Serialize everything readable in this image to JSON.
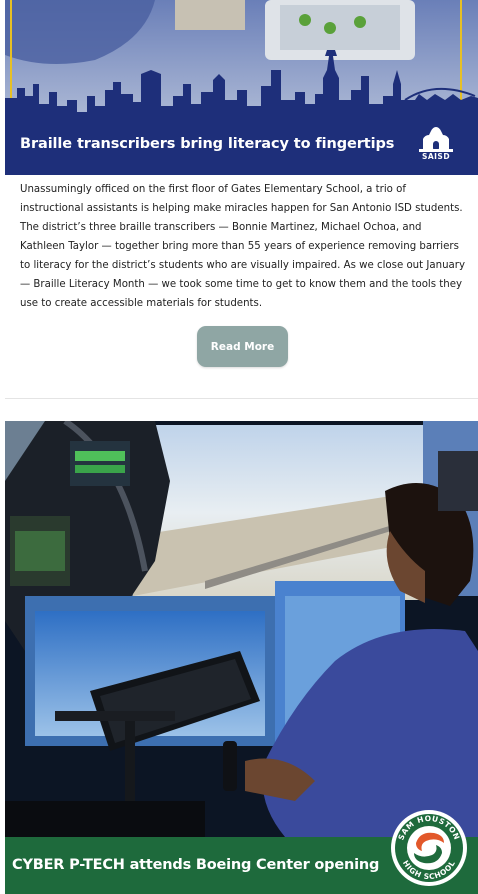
{
  "colors": {
    "saisd_banner": "#1e2f7a",
    "read_more_button": "#8fa6a4",
    "sam_houston_banner": "#1e6a3c",
    "sam_houston_orange": "#e2582a"
  },
  "stories": [
    {
      "title": "Braille transcribers bring literacy to fingertips",
      "logo_text": "SAISD",
      "logo_icon": "saisd-alamo-icon",
      "body": "Unassumingly officed on the first floor of Gates Elementary School, a trio of instructional assistants is helping make miracles happen for San Antonio ISD students. The district’s three braille transcribers — Bonnie Martinez, Michael Ochoa, and Kathleen Taylor — together bring more than 55 years of experience removing barriers to literacy for the district’s students who are visually impaired. As we close out January — Braille Literacy Month — we took some time to get to know them and the tools they use to create accessible materials for students.",
      "read_more_label": "Read More"
    },
    {
      "title": "CYBER P-TECH attends Boeing Center opening",
      "logo_text": "SAM HOUSTON HIGH SCHOOL",
      "logo_icon": "sam-houston-swirl-icon"
    }
  ]
}
